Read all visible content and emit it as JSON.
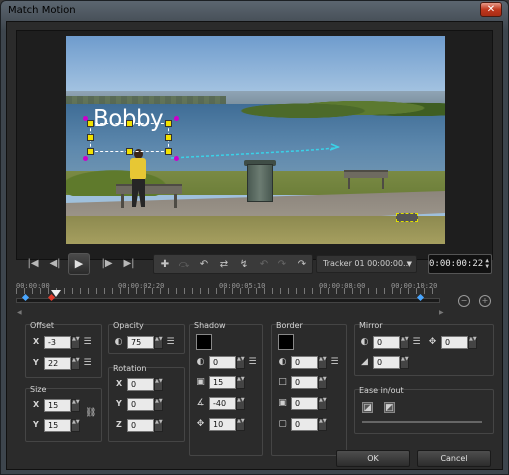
{
  "window": {
    "title": "Match Motion",
    "close_label": "✕"
  },
  "preview": {
    "overlay_text": "Bobby"
  },
  "transport": {
    "tracker_label": "Tracker 01   00:00:00..",
    "timecode": "0:00:00:22"
  },
  "timeline": {
    "labels": [
      "00:00:00",
      "00:00:02:20",
      "00:00:05:10",
      "00:00:08:00",
      "00:00:10:20"
    ]
  },
  "offset": {
    "label": "Offset",
    "x_axis": "X",
    "y_axis": "Y",
    "x": "-3",
    "y": "22"
  },
  "opacity": {
    "label": "Opacity",
    "value": "75"
  },
  "rotation": {
    "label": "Rotation",
    "x_axis": "X",
    "y_axis": "Y",
    "z_axis": "Z",
    "x": "0",
    "y": "0",
    "z": "0"
  },
  "size": {
    "label": "Size",
    "x_axis": "X",
    "y_axis": "Y",
    "x": "15",
    "y": "15"
  },
  "shadow": {
    "label": "Shadow",
    "opacity": "0",
    "blur": "15",
    "angle": "-40",
    "distance": "10",
    "color": "#000000"
  },
  "border": {
    "label": "Border",
    "v1": "0",
    "v2": "0",
    "v3": "0",
    "v4": "0",
    "color": "#000000"
  },
  "mirror": {
    "label": "Mirror",
    "v1": "0",
    "v2": "0",
    "v3": "0"
  },
  "ease": {
    "label": "Ease in/out"
  },
  "footer": {
    "ok": "OK",
    "cancel": "Cancel"
  },
  "colors": {
    "accent_handle": "#f2e200",
    "keyframe": "#49a6ff",
    "keyframe_current": "#e03a2a"
  }
}
